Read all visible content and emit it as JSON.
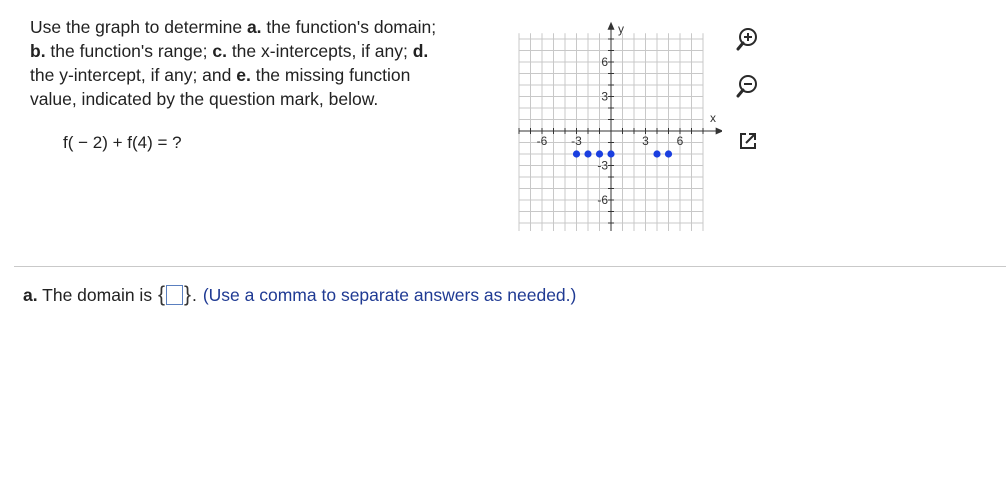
{
  "question": {
    "line1_text": "Use the graph to determine ",
    "line1_bold": "a.",
    "line1_rest": " the function's domain;",
    "line2_bold1": "b.",
    "line2_text": " the function's range; ",
    "line2_bold2": "c.",
    "line2_rest": " the x-intercepts, if any; ",
    "line2_bold3": "d.",
    "line3_text": " the y-intercept, if any; and ",
    "line3_bold": "e.",
    "line3_rest": " the missing function",
    "line4_text": "value, indicated by the question mark, below."
  },
  "expression": "f( − 2) + f(4) = ?",
  "graph": {
    "x_axis_label": "x",
    "y_axis_label": "y",
    "x_tick_labels": [
      "-6",
      "-3",
      "3",
      "6"
    ],
    "y_tick_labels": [
      "6",
      "3",
      "-3",
      "-6"
    ],
    "point_color": "#1a3fe0",
    "points": [
      [
        -3,
        -2
      ],
      [
        -2,
        -2
      ],
      [
        -1,
        -2
      ],
      [
        0,
        -2
      ],
      [
        4,
        -2
      ],
      [
        5,
        -2
      ]
    ]
  },
  "tools": {
    "zoom_in_icon": "zoom-in-icon",
    "zoom_out_icon": "zoom-out-icon",
    "expand_icon": "expand-icon"
  },
  "answer": {
    "prefix_bold": "a.",
    "prefix_text": " The domain is ",
    "open_brace": "{",
    "close_brace": "}",
    "period": ".",
    "hint": "(Use a comma to separate answers as needed.)",
    "input_value": ""
  }
}
